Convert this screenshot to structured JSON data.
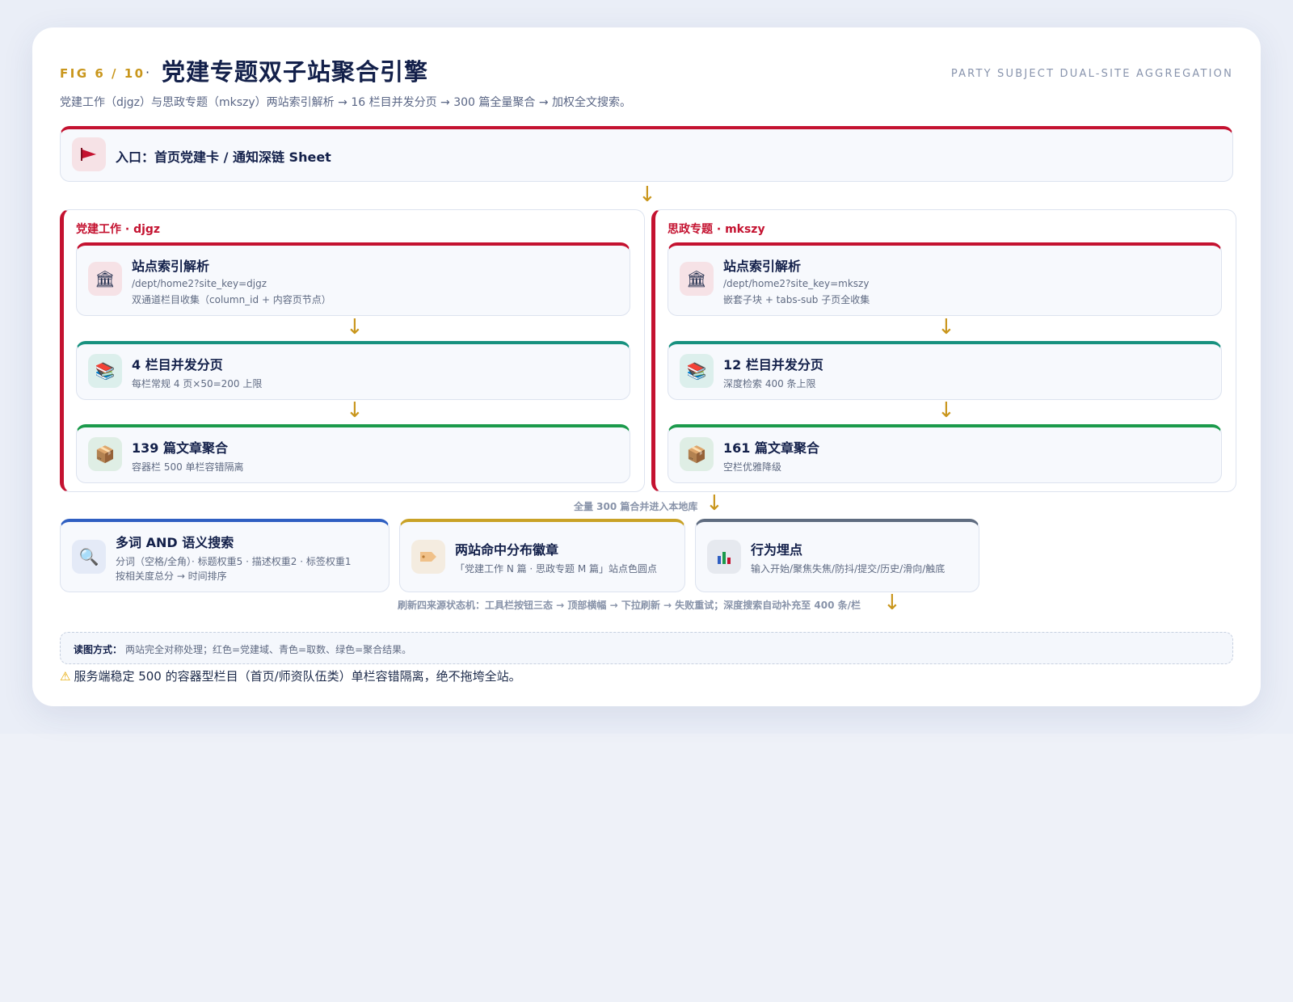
{
  "header": {
    "fig_label": "FIG 6 / 10",
    "separator": "·",
    "title": "党建专题双子站聚合引擎",
    "subtitle_en": "PARTY SUBJECT DUAL-SITE AGGREGATION",
    "description": "党建工作（djgz）与思政专题（mkszy）两站索引解析 → 16 栏目并发分页 → 300 篇全量聚合 → 加权全文搜索。"
  },
  "entry": {
    "icon": "flag-icon",
    "label": "入口：首页党建卡 / 通知深链 Sheet"
  },
  "panels": [
    {
      "label": "党建工作 · djgz",
      "steps": [
        {
          "icon": "classical-building-icon",
          "title": "站点索引解析",
          "lines": [
            "/dept/home2?site_key=djgz",
            "双通道栏目收集（column_id + 内容页节点）"
          ]
        },
        {
          "icon": "books-icon",
          "title": "4 栏目并发分页",
          "lines": [
            "每栏常规 4 页×50=200 上限"
          ]
        },
        {
          "icon": "package-icon",
          "title": "139 篇文章聚合",
          "lines": [
            "容器栏 500 单栏容错隔离"
          ]
        }
      ]
    },
    {
      "label": "思政专题 · mkszy",
      "steps": [
        {
          "icon": "classical-building-icon",
          "title": "站点索引解析",
          "lines": [
            "/dept/home2?site_key=mkszy",
            "嵌套子块 + tabs-sub 子页全收集"
          ]
        },
        {
          "icon": "books-icon",
          "title": "12 栏目并发分页",
          "lines": [
            "深度检索 400 条上限"
          ]
        },
        {
          "icon": "package-icon",
          "title": "161 篇文章聚合",
          "lines": [
            "空栏优雅降级"
          ]
        }
      ]
    }
  ],
  "merge_note": "全量 300 篇合并进入本地库",
  "features": [
    {
      "icon": "magnifier-icon",
      "title": "多词 AND 语义搜索",
      "lines": [
        "分词（空格/全角）· 标题权重5 · 描述权重2 · 标签权重1",
        "按相关度总分 → 时间排序"
      ]
    },
    {
      "icon": "tag-icon",
      "title": "两站命中分布徽章",
      "lines": [
        "「党建工作 N 篇 · 思政专题 M 篇」站点色圆点"
      ]
    },
    {
      "icon": "bar-chart-icon",
      "title": "行为埋点",
      "lines": [
        "输入开始/聚焦失焦/防抖/提交/历史/滑向/触底"
      ]
    }
  ],
  "refresh_note": "刷新四来源状态机：工具栏按钮三态 → 顶部横幅 → 下拉刷新 → 失败重试；深度搜索自动补充至 400 条/栏",
  "legend": {
    "label": "读图方式：",
    "text": "两站完全对称处理；红色=党建域、青色=取数、绿色=聚合结果。"
  },
  "warning": {
    "icon": "warning-icon",
    "text": "服务端稳定 500 的容器型栏目（首页/师资队伍类）单栏容错隔离，绝不拖垮全站。"
  },
  "colors": {
    "party_red": "#c41230",
    "fetch_teal": "#17917f",
    "result_green": "#1b9a4b",
    "accent_gold": "#c9961c"
  }
}
